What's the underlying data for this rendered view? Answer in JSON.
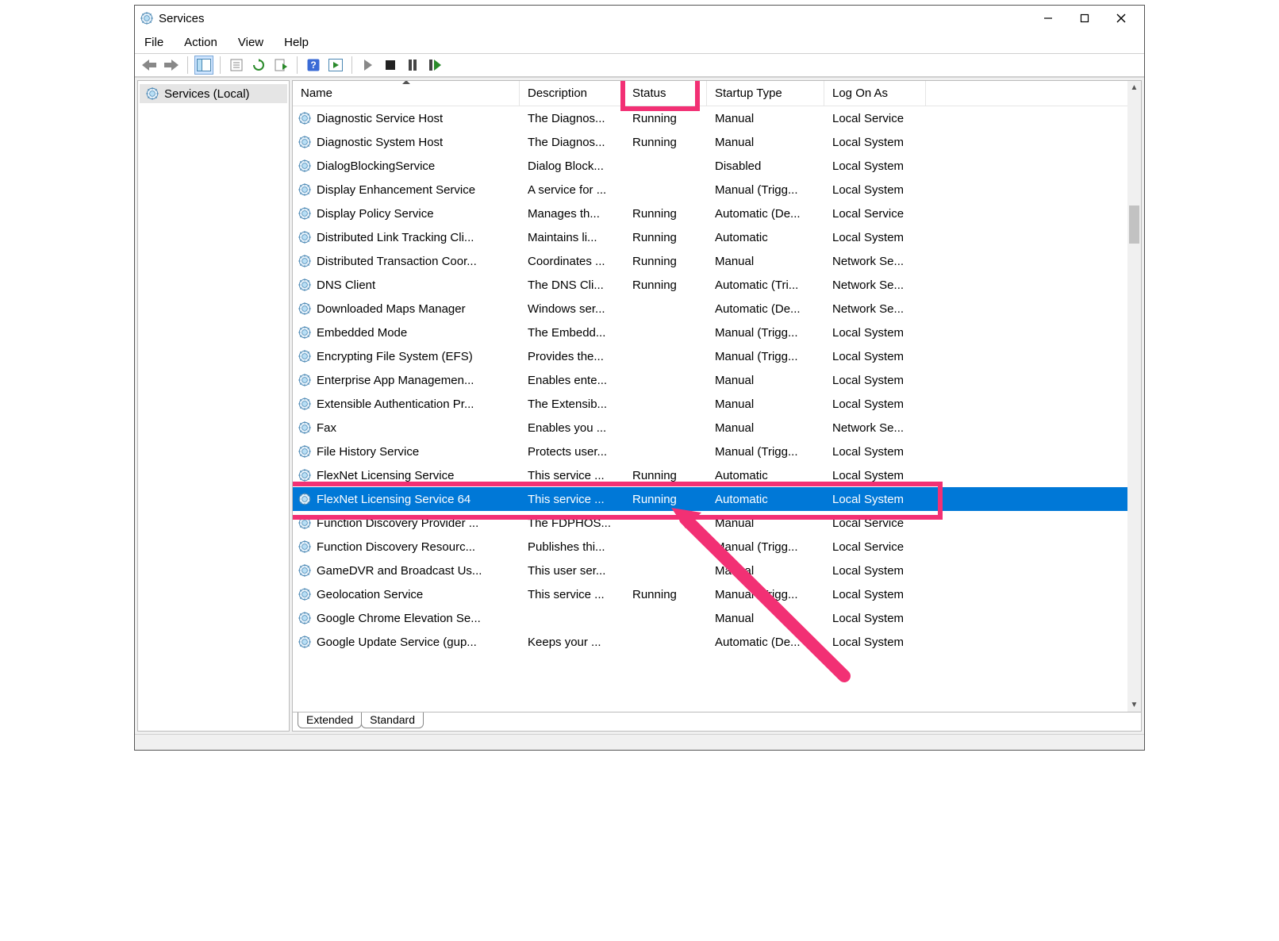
{
  "window": {
    "title": "Services"
  },
  "menu": {
    "file": "File",
    "action": "Action",
    "view": "View",
    "help": "Help"
  },
  "sidebar": {
    "root": "Services (Local)"
  },
  "columns": {
    "name": "Name",
    "description": "Description",
    "status": "Status",
    "startup": "Startup Type",
    "logon": "Log On As"
  },
  "tabs": {
    "extended": "Extended",
    "standard": "Standard"
  },
  "services": [
    {
      "name": "Diagnostic Service Host",
      "desc": "The Diagnos...",
      "status": "Running",
      "startup": "Manual",
      "logon": "Local Service"
    },
    {
      "name": "Diagnostic System Host",
      "desc": "The Diagnos...",
      "status": "Running",
      "startup": "Manual",
      "logon": "Local System"
    },
    {
      "name": "DialogBlockingService",
      "desc": "Dialog Block...",
      "status": "",
      "startup": "Disabled",
      "logon": "Local System"
    },
    {
      "name": "Display Enhancement Service",
      "desc": "A service for ...",
      "status": "",
      "startup": "Manual (Trigg...",
      "logon": "Local System"
    },
    {
      "name": "Display Policy Service",
      "desc": "Manages th...",
      "status": "Running",
      "startup": "Automatic (De...",
      "logon": "Local Service"
    },
    {
      "name": "Distributed Link Tracking Cli...",
      "desc": "Maintains li...",
      "status": "Running",
      "startup": "Automatic",
      "logon": "Local System"
    },
    {
      "name": "Distributed Transaction Coor...",
      "desc": "Coordinates ...",
      "status": "Running",
      "startup": "Manual",
      "logon": "Network Se..."
    },
    {
      "name": "DNS Client",
      "desc": "The DNS Cli...",
      "status": "Running",
      "startup": "Automatic (Tri...",
      "logon": "Network Se..."
    },
    {
      "name": "Downloaded Maps Manager",
      "desc": "Windows ser...",
      "status": "",
      "startup": "Automatic (De...",
      "logon": "Network Se..."
    },
    {
      "name": "Embedded Mode",
      "desc": "The Embedd...",
      "status": "",
      "startup": "Manual (Trigg...",
      "logon": "Local System"
    },
    {
      "name": "Encrypting File System (EFS)",
      "desc": "Provides the...",
      "status": "",
      "startup": "Manual (Trigg...",
      "logon": "Local System"
    },
    {
      "name": "Enterprise App Managemen...",
      "desc": "Enables ente...",
      "status": "",
      "startup": "Manual",
      "logon": "Local System"
    },
    {
      "name": "Extensible Authentication Pr...",
      "desc": "The Extensib...",
      "status": "",
      "startup": "Manual",
      "logon": "Local System"
    },
    {
      "name": "Fax",
      "desc": "Enables you ...",
      "status": "",
      "startup": "Manual",
      "logon": "Network Se..."
    },
    {
      "name": "File History Service",
      "desc": "Protects user...",
      "status": "",
      "startup": "Manual (Trigg...",
      "logon": "Local System"
    },
    {
      "name": "FlexNet Licensing Service",
      "desc": "This service ...",
      "status": "Running",
      "startup": "Automatic",
      "logon": "Local System"
    },
    {
      "name": "FlexNet Licensing Service 64",
      "desc": "This service ...",
      "status": "Running",
      "startup": "Automatic",
      "logon": "Local System",
      "selected": true
    },
    {
      "name": "Function Discovery Provider ...",
      "desc": "The FDPHOS...",
      "status": "",
      "startup": "Manual",
      "logon": "Local Service"
    },
    {
      "name": "Function Discovery Resourc...",
      "desc": "Publishes thi...",
      "status": "",
      "startup": "Manual (Trigg...",
      "logon": "Local Service"
    },
    {
      "name": "GameDVR and Broadcast Us...",
      "desc": "This user ser...",
      "status": "",
      "startup": "Manual",
      "logon": "Local System"
    },
    {
      "name": "Geolocation Service",
      "desc": "This service ...",
      "status": "Running",
      "startup": "Manual (Trigg...",
      "logon": "Local System"
    },
    {
      "name": "Google Chrome Elevation Se...",
      "desc": "",
      "status": "",
      "startup": "Manual",
      "logon": "Local System"
    },
    {
      "name": "Google Update Service (gup...",
      "desc": "Keeps your ...",
      "status": "",
      "startup": "Automatic (De...",
      "logon": "Local System"
    }
  ],
  "annotations": {
    "status_header_highlight": true,
    "selected_row_highlight": true,
    "arrow_to_status_cell": true
  }
}
